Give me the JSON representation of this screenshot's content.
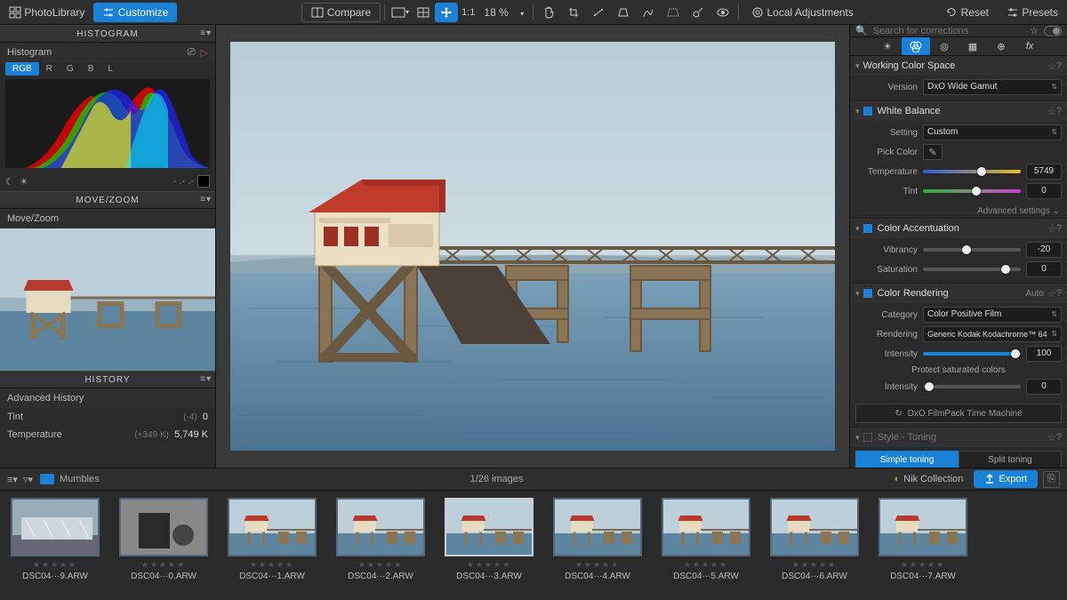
{
  "topbar": {
    "photo_library": "PhotoLibrary",
    "customize": "Customize",
    "compare": "Compare",
    "ratio": "1:1",
    "zoom": "18 %",
    "local_adj": "Local Adjustments",
    "reset": "Reset",
    "presets": "Presets"
  },
  "left": {
    "histogram": {
      "title": "HISTOGRAM",
      "sub": "Histogram",
      "tabs": [
        "RGB",
        "R",
        "G",
        "B",
        "L"
      ],
      "active_tab": 0
    },
    "movezoom": {
      "title": "MOVE/ZOOM",
      "sub": "Move/Zoom"
    },
    "history": {
      "title": "HISTORY",
      "sub": "Advanced History",
      "rows": [
        {
          "label": "Tint",
          "delta": "(-4)",
          "value": "0"
        },
        {
          "label": "Temperature",
          "delta": "(+349 K)",
          "value": "5,749 K"
        }
      ]
    }
  },
  "right": {
    "search_placeholder": "Search for corrections",
    "working_color": {
      "title": "Working Color Space",
      "version_label": "Version",
      "version": "DxO Wide Gamut"
    },
    "white_balance": {
      "title": "White Balance",
      "setting_label": "Setting",
      "setting": "Custom",
      "pick_label": "Pick Color",
      "temp_label": "Temperature",
      "temp_value": "5749",
      "tint_label": "Tint",
      "tint_value": "0",
      "adv": "Advanced settings"
    },
    "color_accent": {
      "title": "Color Accentuation",
      "vibrancy_label": "Vibrancy",
      "vibrancy_value": "-20",
      "saturation_label": "Saturation",
      "saturation_value": "0"
    },
    "color_render": {
      "title": "Color Rendering",
      "auto": "Auto",
      "category_label": "Category",
      "category": "Color Positive Film",
      "rendering_label": "Rendering",
      "rendering": "Generic Kodak Kodachrome™ 64",
      "intensity_label": "Intensity",
      "intensity_value": "100",
      "protect": "Protect saturated colors",
      "intensity2_label": "Intensity",
      "intensity2_value": "0",
      "filmpack": "DxO FilmPack Time Machine"
    },
    "style_toning": {
      "title": "Style - Toning",
      "simple": "Simple toning",
      "split": "Split toning"
    }
  },
  "filmstrip": {
    "folder": "Mumbles",
    "count": "1/26 images",
    "nik": "Nik Collection",
    "export": "Export",
    "thumbs": [
      {
        "name": "DSC04···9.ARW"
      },
      {
        "name": "DSC04···0.ARW"
      },
      {
        "name": "DSC04···1.ARW"
      },
      {
        "name": "DSC04···2.ARW"
      },
      {
        "name": "DSC04···3.ARW"
      },
      {
        "name": "DSC04···4.ARW"
      },
      {
        "name": "DSC04···5.ARW"
      },
      {
        "name": "DSC04···6.ARW"
      },
      {
        "name": "DSC04···7.ARW"
      }
    ],
    "selected_index": 4
  }
}
